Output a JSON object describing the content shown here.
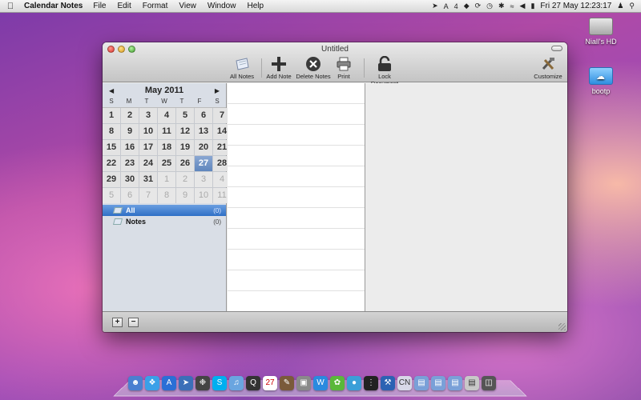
{
  "menubar": {
    "app_name": "Calendar Notes",
    "items": [
      "File",
      "Edit",
      "Format",
      "View",
      "Window",
      "Help"
    ],
    "status_text": "4",
    "clock": "Fri 27 May  12:23:17"
  },
  "desktop": {
    "drives": [
      {
        "label": "Niall's HD",
        "icon": "hard-drive-icon"
      },
      {
        "label": "bootp",
        "icon": "usb-drive-icon"
      }
    ]
  },
  "window": {
    "title": "Untitled",
    "toolbar": {
      "all_notes": "All Notes",
      "add_note": "Add Note",
      "delete_notes": "Delete Notes",
      "print": "Print",
      "lock_document": "Lock Document",
      "customize": "Customize"
    },
    "calendar": {
      "month_title": "May 2011",
      "weekdays": [
        "S",
        "M",
        "T",
        "W",
        "T",
        "F",
        "S"
      ],
      "days": [
        {
          "n": "1"
        },
        {
          "n": "2"
        },
        {
          "n": "3"
        },
        {
          "n": "4"
        },
        {
          "n": "5"
        },
        {
          "n": "6"
        },
        {
          "n": "7"
        },
        {
          "n": "8"
        },
        {
          "n": "9"
        },
        {
          "n": "10"
        },
        {
          "n": "11"
        },
        {
          "n": "12"
        },
        {
          "n": "13"
        },
        {
          "n": "14"
        },
        {
          "n": "15"
        },
        {
          "n": "16"
        },
        {
          "n": "17"
        },
        {
          "n": "18"
        },
        {
          "n": "19"
        },
        {
          "n": "20"
        },
        {
          "n": "21"
        },
        {
          "n": "22"
        },
        {
          "n": "23"
        },
        {
          "n": "24"
        },
        {
          "n": "25"
        },
        {
          "n": "26"
        },
        {
          "n": "27",
          "today": true
        },
        {
          "n": "28"
        },
        {
          "n": "29"
        },
        {
          "n": "30"
        },
        {
          "n": "31"
        },
        {
          "n": "1",
          "dim": true
        },
        {
          "n": "2",
          "dim": true
        },
        {
          "n": "3",
          "dim": true
        },
        {
          "n": "4",
          "dim": true
        },
        {
          "n": "5",
          "dim": true
        },
        {
          "n": "6",
          "dim": true
        },
        {
          "n": "7",
          "dim": true
        },
        {
          "n": "8",
          "dim": true
        },
        {
          "n": "9",
          "dim": true
        },
        {
          "n": "10",
          "dim": true
        },
        {
          "n": "11",
          "dim": true
        }
      ]
    },
    "sources": [
      {
        "label": "All",
        "count": "(0)",
        "selected": true
      },
      {
        "label": "Notes",
        "count": "(0)",
        "selected": false
      }
    ],
    "bottom": {
      "add": "+",
      "remove": "−"
    }
  },
  "colors": {
    "selection": "#2f6fc6",
    "today": "#5f86bd"
  }
}
